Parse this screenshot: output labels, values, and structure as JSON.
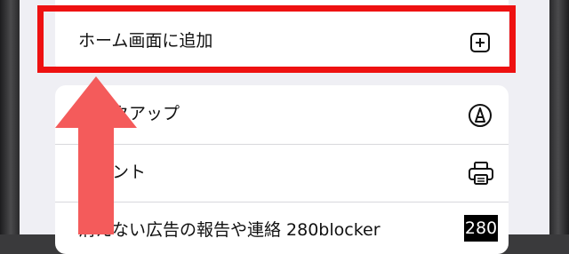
{
  "share_menu": {
    "add_to_home": {
      "label": "ホーム画面に追加",
      "icon": "plus-square-icon"
    },
    "items": [
      {
        "label": "マークアップ",
        "icon": "markup-pen-icon"
      },
      {
        "label": "プリント",
        "icon": "printer-icon"
      },
      {
        "label": "消えない広告の報告や連絡 280blocker",
        "icon": "280blocker-app-icon"
      }
    ],
    "badge_text": "280"
  },
  "annotation": {
    "highlight_color": "#ee1111",
    "arrow_color": "#f45b5b"
  }
}
